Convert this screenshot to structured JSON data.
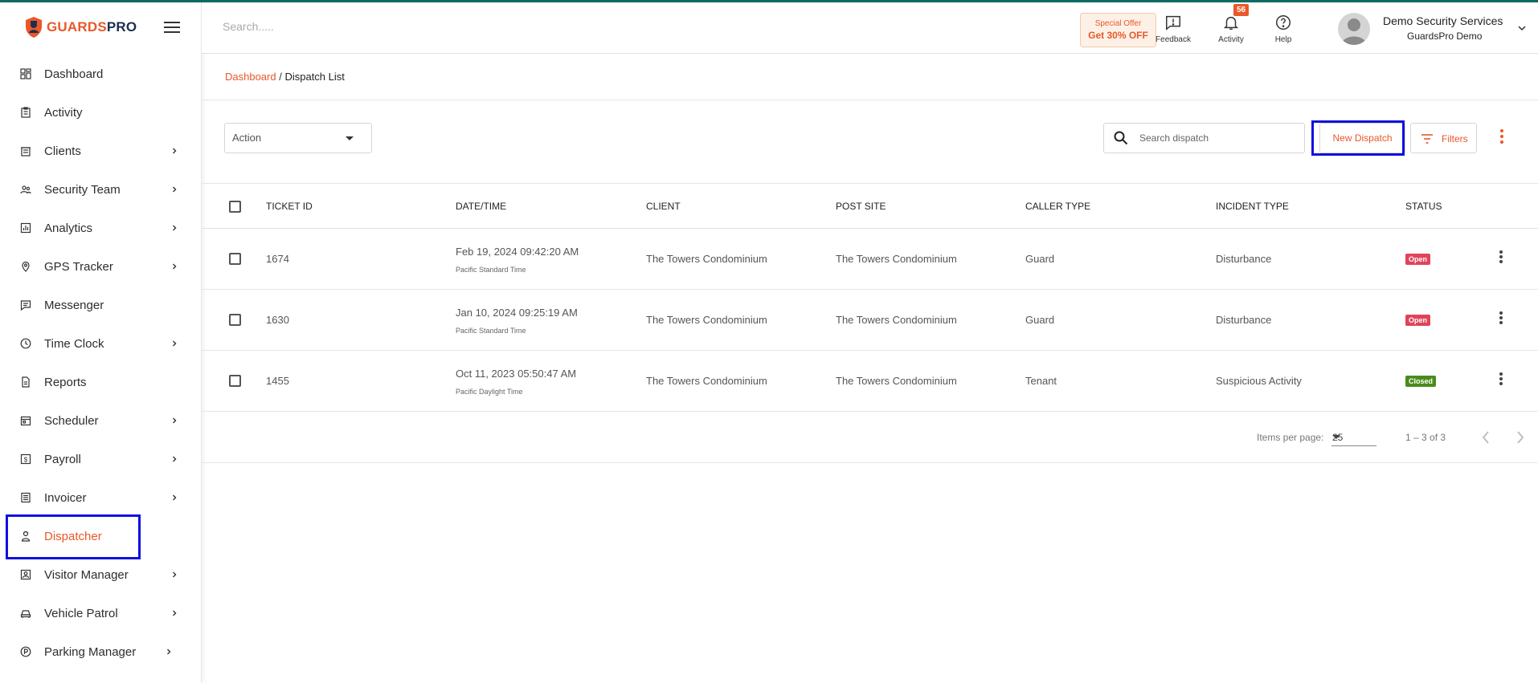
{
  "app": {
    "brand_part1": "GUARDS",
    "brand_part2": "PRO",
    "accent_color": "#e8582a",
    "highlight_color": "#1010e0"
  },
  "header": {
    "search_placeholder": "Search.....",
    "offer_line1": "Special Offer",
    "offer_line2": "Get 30% OFF",
    "feedback_label": "Feedback",
    "activity_label": "Activity",
    "activity_badge": "56",
    "help_label": "Help",
    "user_name": "Demo Security Services",
    "user_org": "GuardsPro Demo"
  },
  "sidebar": {
    "items": [
      {
        "label": "Dashboard",
        "icon": "dashboard-icon",
        "has_children": false
      },
      {
        "label": "Activity",
        "icon": "clipboard-icon",
        "has_children": false
      },
      {
        "label": "Clients",
        "icon": "building-icon",
        "has_children": true
      },
      {
        "label": "Security Team",
        "icon": "team-icon",
        "has_children": true
      },
      {
        "label": "Analytics",
        "icon": "analytics-icon",
        "has_children": true
      },
      {
        "label": "GPS Tracker",
        "icon": "location-pin-icon",
        "has_children": true
      },
      {
        "label": "Messenger",
        "icon": "message-icon",
        "has_children": false
      },
      {
        "label": "Time Clock",
        "icon": "clock-icon",
        "has_children": true
      },
      {
        "label": "Reports",
        "icon": "document-icon",
        "has_children": false
      },
      {
        "label": "Scheduler",
        "icon": "calendar-icon",
        "has_children": true
      },
      {
        "label": "Payroll",
        "icon": "payroll-icon",
        "has_children": true
      },
      {
        "label": "Invoicer",
        "icon": "invoice-icon",
        "has_children": true
      },
      {
        "label": "Dispatcher",
        "icon": "dispatcher-icon",
        "has_children": false,
        "active": true
      },
      {
        "label": "Visitor Manager",
        "icon": "visitor-icon",
        "has_children": true
      },
      {
        "label": "Vehicle Patrol",
        "icon": "car-icon",
        "has_children": true
      },
      {
        "label": "Parking Manager",
        "icon": "parking-icon",
        "has_children": true
      }
    ]
  },
  "breadcrumb": {
    "root": "Dashboard",
    "separator": " / ",
    "current": "Dispatch List"
  },
  "toolbar": {
    "action_label": "Action",
    "search_placeholder": "Search dispatch",
    "new_dispatch_label": "New Dispatch",
    "filters_label": "Filters"
  },
  "table": {
    "columns": [
      "TICKET ID",
      "DATE/TIME",
      "CLIENT",
      "POST SITE",
      "CALLER TYPE",
      "INCIDENT TYPE",
      "STATUS"
    ],
    "rows": [
      {
        "ticket_id": "1674",
        "datetime": "Feb 19, 2024 09:42:20 AM",
        "timezone": "Pacific Standard Time",
        "client": "The Towers Condominium",
        "post_site": "The Towers Condominium",
        "caller_type": "Guard",
        "incident_type": "Disturbance",
        "status": "Open",
        "status_color": "#e0445a"
      },
      {
        "ticket_id": "1630",
        "datetime": "Jan 10, 2024 09:25:19 AM",
        "timezone": "Pacific Standard Time",
        "client": "The Towers Condominium",
        "post_site": "The Towers Condominium",
        "caller_type": "Guard",
        "incident_type": "Disturbance",
        "status": "Open",
        "status_color": "#e0445a"
      },
      {
        "ticket_id": "1455",
        "datetime": "Oct 11, 2023 05:50:47 AM",
        "timezone": "Pacific Daylight Time",
        "client": "The Towers Condominium",
        "post_site": "The Towers Condominium",
        "caller_type": "Tenant",
        "incident_type": "Suspicious Activity",
        "status": "Closed",
        "status_color": "#4a8c1c"
      }
    ]
  },
  "paginator": {
    "items_per_page_label": "Items per page:",
    "items_per_page": "25",
    "range": "1 – 3 of 3"
  }
}
